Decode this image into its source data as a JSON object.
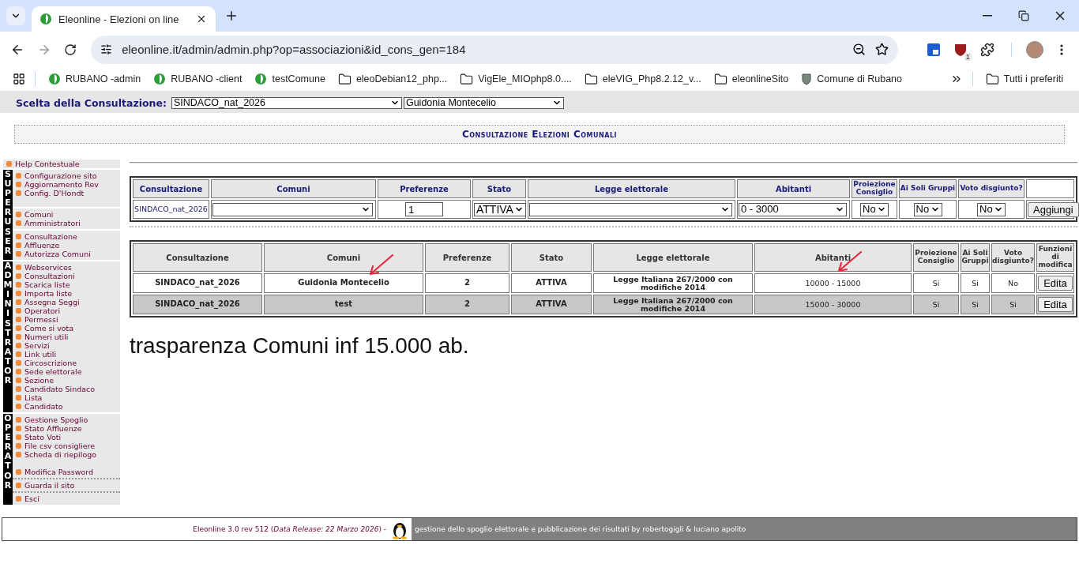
{
  "browser": {
    "tab_title": "Eleonline - Elezioni on line",
    "url": "eleonline.it/admin/admin.php?op=associazioni&id_cons_gen=184",
    "extension_badge": "1",
    "bookmarks": [
      {
        "label": "RUBANO -admin",
        "kind": "leaf"
      },
      {
        "label": "RUBANO -client",
        "kind": "leaf"
      },
      {
        "label": "testComune",
        "kind": "leaf"
      },
      {
        "label": "eleoDebian12_php...",
        "kind": "folder"
      },
      {
        "label": "VigEle_MIOphp8.0....",
        "kind": "folder"
      },
      {
        "label": "eleVIG_Php8.2.12_v...",
        "kind": "folder"
      },
      {
        "label": "eleonlineSito",
        "kind": "folder"
      },
      {
        "label": "Comune di Rubano",
        "kind": "crest"
      }
    ],
    "all_bookmarks": "Tutti i preferiti"
  },
  "consultation_bar": {
    "label": "Scelta della Consultazione:",
    "consultation": "SINDACO_nat_2026",
    "comune": "Guidonia Montecelio"
  },
  "header_title": "Consultazione Elezioni Comunali",
  "sidebar": {
    "help": "Help Contestuale",
    "sections": [
      {
        "label": "SUPERUSER",
        "groups": [
          [
            "Configurazione sito",
            "Aggiornamento Rev",
            "Config. D'Hondt"
          ],
          [
            "Comuni",
            "Amministratori"
          ],
          [
            "Consultazione",
            "Affluenze",
            "Autorizza Comuni"
          ]
        ]
      },
      {
        "label": "ADMINISTRATOR",
        "groups": [
          [
            "Webservices",
            "Consultazioni",
            "Scarica liste",
            "Importa liste",
            "Assegna Seggi",
            "Operatori",
            "Permessi",
            "Come si vota",
            "Numeri utili",
            "Servizi",
            "Link utili",
            "Circoscrizione",
            "Sede elettorale",
            "Sezione",
            "Candidato Sindaco",
            "Lista",
            "Candidato"
          ]
        ]
      },
      {
        "label": "OPERATOR",
        "groups": [
          [
            "Gestione Spoglio",
            "Stato Affluenze",
            "Stato Voti",
            "File csv consigliere",
            "Scheda di riepilogo",
            "Modifica Password"
          ],
          [
            "Guarda il sito"
          ],
          [
            "Esci"
          ]
        ]
      }
    ]
  },
  "add_form": {
    "columns": [
      "Consultazione",
      "Comuni",
      "Preferenze",
      "Stato",
      "Legge elettorale",
      "Abitanti",
      "Proiezione Consiglio",
      "Ai Soli Gruppi",
      "Voto disgiunto?"
    ],
    "consultation": "SINDACO_nat_2026",
    "preferenze": "1",
    "stato": "ATTIVA",
    "abitanti": "0 - 3000",
    "proiezione": "No",
    "soli_gruppi": "No",
    "disgiunto": "No",
    "button": "Aggiungi"
  },
  "table": {
    "columns": [
      "Consultazione",
      "Comuni",
      "Preferenze",
      "Stato",
      "Legge elettorale",
      "Abitanti",
      "Proiezione Consiglio",
      "Ai Soli Gruppi",
      "Voto disgiunto?",
      "Funzioni di modifica"
    ],
    "rows": [
      {
        "shaded": false,
        "cells": [
          "SINDACO_nat_2026",
          "Guidonia Montecelio",
          "2",
          "ATTIVA",
          "Legge Italiana 267/2000 con modifiche 2014",
          "10000 - 15000",
          "Si",
          "Si",
          "No"
        ],
        "button": "Edita"
      },
      {
        "shaded": true,
        "cells": [
          "SINDACO_nat_2026",
          "test",
          "2",
          "ATTIVA",
          "Legge Italiana 267/2000 con modifiche 2014",
          "15000 - 30000",
          "Si",
          "Si",
          "Si"
        ],
        "button": "Edita"
      }
    ]
  },
  "note": "trasparenza Comuni inf 15.000 ab.",
  "footer": {
    "version": "Eleonline 3.0 rev 512 (*Data Release: 22 Marzo 2026*) -",
    "tagline": "gestione dello spoglio elettorale e pubblicazione dei risultati by robertogigli & luciano apolito"
  }
}
